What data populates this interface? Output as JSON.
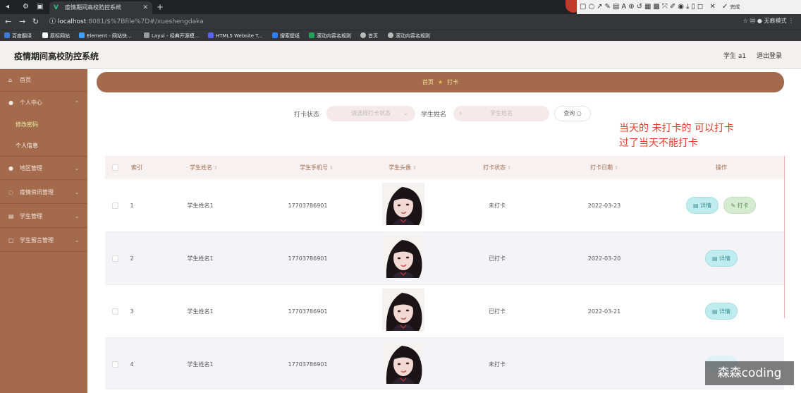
{
  "browser": {
    "tab_title": "疫情期间高校防控系统",
    "url_host": "localhost",
    "url_rest": ":8081/$%7Bfile%7D#/xueshengdaka",
    "addr_right": "无痕模式",
    "bookmarks": [
      "百度翻译",
      "原标网站",
      "Element - 网站快...",
      "Layui - 经典开源模...",
      "HTML5 Website T...",
      "搜索壁纸",
      "滚动内容名规则",
      "首页",
      "滚动内容名规则"
    ]
  },
  "annot_toolbar": {
    "font_size": "20",
    "done": "完成",
    "colors": [
      "#000000",
      "#7f7f7f",
      "#880015",
      "#ed1c24",
      "#ff7f27",
      "#fff200",
      "#22b14c",
      "#00a2e8",
      "#3f48cc",
      "#a349a4",
      "#ffffff",
      "#c3c3c3",
      "#b97a57",
      "#ffaec9",
      "#ffc90e",
      "#efe4b0",
      "#b5e61d",
      "#99d9ea",
      "#7092be",
      "#c8bfe7"
    ]
  },
  "header": {
    "title": "疫情期间高校防控系统",
    "user": "学生 a1",
    "logout": "退出登录"
  },
  "sidebar": {
    "items": [
      {
        "label": "首页",
        "icon": "home-icon"
      },
      {
        "label": "个人中心",
        "icon": "user-icon"
      },
      {
        "label": "修改密码",
        "icon": ""
      },
      {
        "label": "个人信息",
        "icon": ""
      },
      {
        "label": "地区管理",
        "icon": "user-icon"
      },
      {
        "label": "疫情资讯管理",
        "icon": "info-icon"
      },
      {
        "label": "学生管理",
        "icon": "list-icon"
      },
      {
        "label": "学生留言管理",
        "icon": "message-icon"
      }
    ]
  },
  "breadcrumb": {
    "home": "首页",
    "current": "打卡"
  },
  "search": {
    "status_label": "打卡状态",
    "status_placeholder": "请选择打卡状态",
    "name_label": "学生姓名",
    "name_placeholder": "学生姓名",
    "query_button": "查询"
  },
  "note": {
    "line1": "当天的 未打卡的 可以打卡",
    "line2": "过了当天不能打卡"
  },
  "table": {
    "headers": [
      "索引",
      "学生姓名",
      "学生手机号",
      "学生头像",
      "打卡状态",
      "打卡日期",
      "操作"
    ],
    "detail_label": "详情",
    "punch_label": "打卡",
    "rows": [
      {
        "index": "1",
        "name": "学生姓名1",
        "phone": "17703786901",
        "status": "未打卡",
        "date": "2022-03-23",
        "can_punch": true
      },
      {
        "index": "2",
        "name": "学生姓名1",
        "phone": "17703786901",
        "status": "已打卡",
        "date": "2022-03-20",
        "can_punch": false
      },
      {
        "index": "3",
        "name": "学生姓名1",
        "phone": "17703786901",
        "status": "已打卡",
        "date": "2022-03-21",
        "can_punch": false
      },
      {
        "index": "4",
        "name": "学生姓名1",
        "phone": "17703786901",
        "status": "未打卡",
        "date": "",
        "can_punch": false
      }
    ]
  },
  "watermark": "森森coding"
}
